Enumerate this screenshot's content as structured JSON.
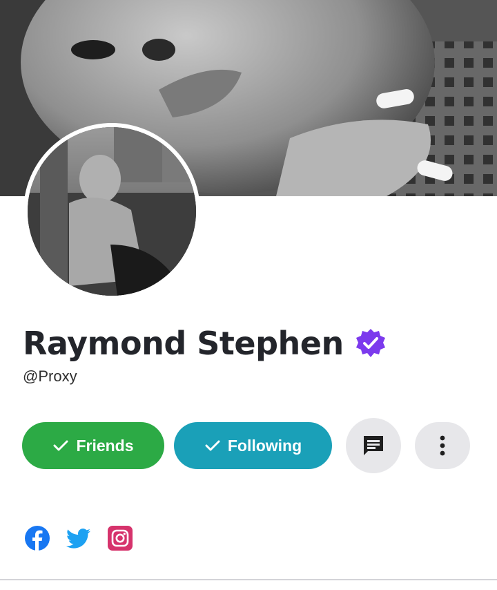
{
  "profile": {
    "name": "Raymond Stephen",
    "handle": "@Proxy",
    "verified": true
  },
  "actions": {
    "friends_label": "Friends",
    "following_label": "Following"
  },
  "icons": {
    "verified": "verified-badge-icon",
    "check": "check-icon",
    "message": "message-icon",
    "more": "more-vertical-icon",
    "facebook": "facebook-icon",
    "twitter": "twitter-icon",
    "instagram": "instagram-icon"
  },
  "colors": {
    "friends_button": "#2caa45",
    "following_button": "#1aa0b8",
    "verified_badge": "#7c3aed",
    "facebook": "#1877f2",
    "twitter": "#1da1f2",
    "instagram": "#d6336c",
    "round_button_bg": "#e7e7ea"
  }
}
